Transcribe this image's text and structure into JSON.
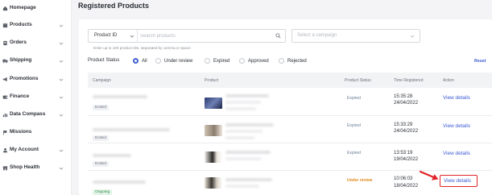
{
  "sidebar": {
    "items": [
      {
        "label": "Homepage",
        "icon": "home-icon",
        "has_chevron": false
      },
      {
        "label": "Products",
        "icon": "box-icon",
        "has_chevron": true
      },
      {
        "label": "Orders",
        "icon": "orders-icon",
        "has_chevron": true
      },
      {
        "label": "Shipping",
        "icon": "truck-icon",
        "has_chevron": true
      },
      {
        "label": "Promotions",
        "icon": "megaphone-icon",
        "has_chevron": true
      },
      {
        "label": "Finance",
        "icon": "wallet-icon",
        "has_chevron": true
      },
      {
        "label": "Data Compass",
        "icon": "chart-icon",
        "has_chevron": true
      },
      {
        "label": "Missions",
        "icon": "flag-icon",
        "has_chevron": false
      },
      {
        "label": "My Account",
        "icon": "user-icon",
        "has_chevron": true
      },
      {
        "label": "Shop Health",
        "icon": "shop-icon",
        "has_chevron": true
      }
    ]
  },
  "page": {
    "title": "Registered Products"
  },
  "filters": {
    "type_select": "Product ID",
    "search_placeholder": "Search products",
    "campaign_placeholder": "Select a campaign",
    "hint": "Enter up to 100 product IDs, separated by comma or space",
    "status_label": "Product Status",
    "status_options": [
      {
        "label": "All",
        "selected": true
      },
      {
        "label": "Under review",
        "selected": false
      },
      {
        "label": "Expired",
        "selected": false
      },
      {
        "label": "Approved",
        "selected": false
      },
      {
        "label": "Rejected",
        "selected": false
      }
    ],
    "reset_label": "Reset"
  },
  "table": {
    "columns": [
      "Campaign",
      "Product",
      "Product Status",
      "Time Registered",
      "Action"
    ],
    "rows": [
      {
        "campaign_tag": "Ended",
        "status": "Expired",
        "time": "15:35:28",
        "date": "24/04/2022",
        "action": "View details"
      },
      {
        "campaign_tag": "Ended",
        "status": "Expired",
        "time": "15:33:29",
        "date": "24/04/2022",
        "action": "View details"
      },
      {
        "campaign_tag": "Ended",
        "status": "Expired",
        "time": "13:53:19",
        "date": "19/04/2022",
        "action": "View details"
      },
      {
        "campaign_tag": "Ongoing",
        "status": "Under review",
        "time": "10:06:03",
        "date": "18/04/2022",
        "action": "View details"
      }
    ]
  },
  "colors": {
    "accent": "#3b5bd6",
    "highlight": "#e0242a",
    "under_review": "#e08a1e",
    "ongoing": "#2e8b47"
  }
}
